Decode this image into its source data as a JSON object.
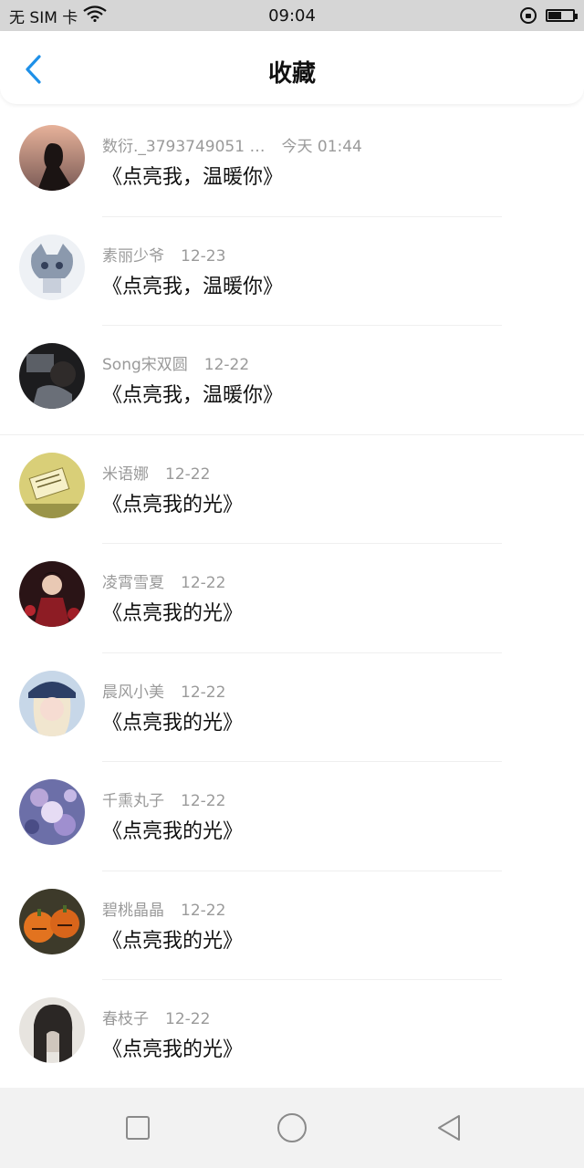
{
  "status_bar": {
    "carrier": "无 SIM 卡",
    "time": "09:04",
    "battery_level": 0.55,
    "icons": [
      "wifi-icon",
      "rotation-lock-icon",
      "battery-icon"
    ]
  },
  "header": {
    "title": "收藏",
    "back_icon": "chevron-left-icon",
    "accent_color": "#1e90e8"
  },
  "favorites": [
    {
      "author": "数衍._3793749051 …",
      "time": "今天 01:44",
      "title": "《点亮我，温暖你》",
      "avatar": "silhouette-sunset"
    },
    {
      "author": "素丽少爷",
      "time": "12-23",
      "title": "《点亮我，温暖你》",
      "avatar": "anime-sketch"
    },
    {
      "author": "Song宋双圆",
      "time": "12-22",
      "title": "《点亮我，温暖你》",
      "avatar": "dark-photo"
    },
    {
      "author": "米语娜",
      "time": "12-22",
      "title": "《点亮我的光》",
      "avatar": "yellow-note"
    },
    {
      "author": "凌霄雪夏",
      "time": "12-22",
      "title": "《点亮我的光》",
      "avatar": "red-flowers-girl"
    },
    {
      "author": "晨风小美",
      "time": "12-22",
      "title": "《点亮我的光》",
      "avatar": "blonde-girl"
    },
    {
      "author": "千熏丸子",
      "time": "12-22",
      "title": "《点亮我的光》",
      "avatar": "purple-art"
    },
    {
      "author": "碧桃晶晶",
      "time": "12-22",
      "title": "《点亮我的光》",
      "avatar": "pumpkins"
    },
    {
      "author": "春枝子",
      "time": "12-22",
      "title": "《点亮我的光》",
      "avatar": "dark-hair-sketch"
    }
  ],
  "nav_bar": {
    "buttons": [
      "recent-apps-icon",
      "home-icon",
      "back-triangle-icon"
    ]
  }
}
